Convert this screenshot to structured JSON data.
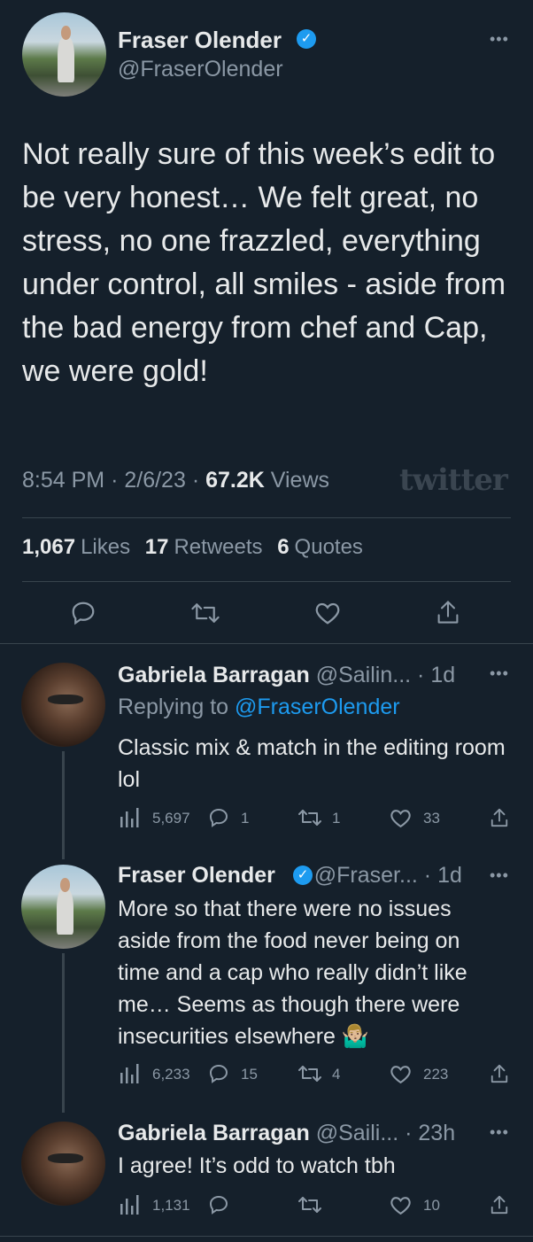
{
  "main_tweet": {
    "author_name": "Fraser Olender",
    "author_handle": "@FraserOlender",
    "text": "Not really sure of this week’s edit to be very honest… We felt great, no stress, no one frazzled, everything under control, all smiles  - aside from the bad energy from chef and Cap, we were gold!",
    "time": "8:54 PM",
    "date": "2/6/23",
    "views_count": "67.2K",
    "views_label": "Views",
    "watermark": "twitter",
    "likes_count": "1,067",
    "likes_label": "Likes",
    "retweets_count": "17",
    "retweets_label": "Retweets",
    "quotes_count": "6",
    "quotes_label": "Quotes"
  },
  "replies": [
    {
      "author_name": "Gabriela Barragan",
      "author_handle": "@Sailin...",
      "age": "1d",
      "replying_prefix": "Replying to",
      "replying_to": "@FraserOlender",
      "text": "Classic mix & match in the editing room lol",
      "views": "5,697",
      "replies": "1",
      "retweets": "1",
      "likes": "33"
    },
    {
      "author_name": "Fraser Olender",
      "author_handle": "@Fraser...",
      "age": "1d",
      "text": "More so that there were no issues aside from the food never being on time and a cap who really didn’t like me… Seems as though there were insecurities elsewhere 🤷🏼‍♂️",
      "views": "6,233",
      "replies": "15",
      "retweets": "4",
      "likes": "223"
    },
    {
      "author_name": "Gabriela Barragan",
      "author_handle": "@Saili...",
      "age": "23h",
      "text": "I agree! It’s odd to watch tbh",
      "views": "1,131",
      "replies": "",
      "retweets": "",
      "likes": "10"
    }
  ],
  "icons": {
    "more": "more-dots-icon",
    "verified": "verified-badge-icon",
    "reply": "reply-icon",
    "retweet": "retweet-icon",
    "like": "heart-icon",
    "share": "share-icon",
    "views": "views-chart-icon"
  },
  "colors": {
    "background": "#15202b",
    "text": "#e7e9ea",
    "secondary": "#8b98a5",
    "accent": "#1d9bf0",
    "divider": "#38444d"
  }
}
